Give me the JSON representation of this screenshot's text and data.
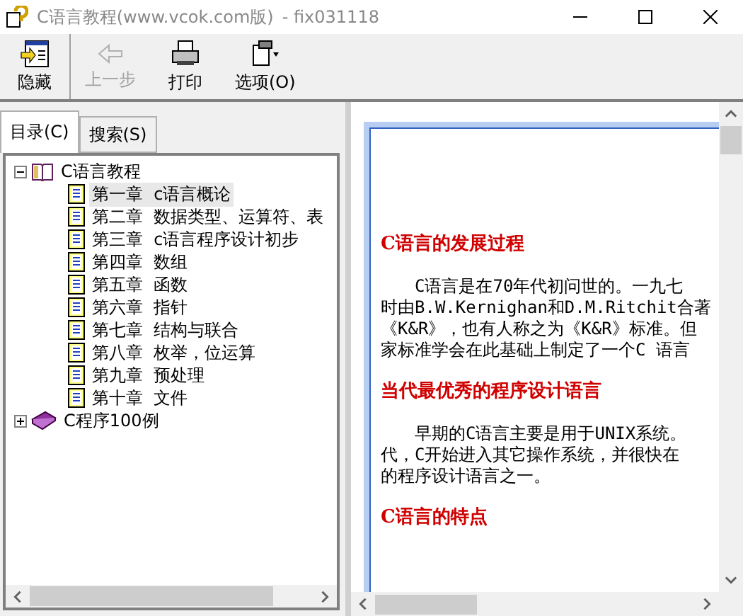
{
  "window": {
    "title": "C语言教程(www.vcok.com版)",
    "subtitle": "- fix031118"
  },
  "toolbar": [
    {
      "label": "隐藏",
      "kind": "hide",
      "disabled": false
    },
    {
      "label": "上一步",
      "kind": "back",
      "disabled": true
    },
    {
      "label": "打印",
      "kind": "print",
      "disabled": false
    },
    {
      "label": "选项(O)",
      "kind": "options",
      "disabled": false
    }
  ],
  "tabs": [
    {
      "label": "目录(C)",
      "selected": true
    },
    {
      "label": "搜索(S)",
      "selected": false
    }
  ],
  "tree": [
    {
      "label": "C语言教程",
      "expanded": true,
      "children": [
        {
          "label": "第一章  c语言概论",
          "selected": true
        },
        {
          "label": "第二章  数据类型、运算符、表",
          "selected": false
        },
        {
          "label": "第三章  c语言程序设计初步",
          "selected": false
        },
        {
          "label": "第四章  数组",
          "selected": false
        },
        {
          "label": "第五章  函数",
          "selected": false
        },
        {
          "label": "第六章  指针",
          "selected": false
        },
        {
          "label": "第七章  结构与联合",
          "selected": false
        },
        {
          "label": "第八章  枚举，位运算",
          "selected": false
        },
        {
          "label": "第九章  预处理",
          "selected": false
        },
        {
          "label": "第十章  文件",
          "selected": false
        }
      ]
    },
    {
      "label": "C程序100例",
      "expanded": false
    }
  ],
  "content": [
    {
      "kind": "heading",
      "lines": [
        "C语言的发展过程"
      ]
    },
    {
      "kind": "paragraph",
      "lines": [
        "C语言是在70年代初问世的。一九七",
        "时由B.W.Kernighan和D.M.Ritchit合著",
        "《K&R》，也有人称之为《K&R》标准。但",
        "家标准学会在此基础上制定了一个C 语言"
      ]
    },
    {
      "kind": "heading",
      "lines": [
        "当代最优秀的程序设计语言"
      ]
    },
    {
      "kind": "paragraph",
      "lines": [
        "早期的C语言主要是用于UNIX系统。",
        "代，C开始进入其它操作系统，并很快在",
        "的程序设计语言之一。"
      ]
    },
    {
      "kind": "heading",
      "lines": [
        "C语言的特点"
      ]
    }
  ]
}
